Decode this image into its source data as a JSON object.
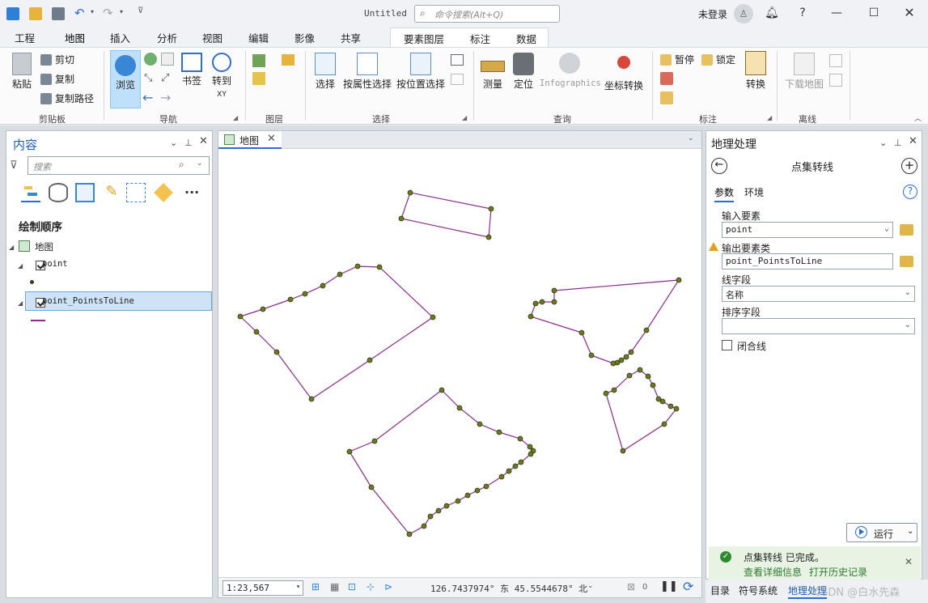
{
  "app": {
    "doc_title": "Untitled",
    "command_search_placeholder": "命令搜索(Alt+Q)",
    "login_label": "未登录",
    "help_label": "?"
  },
  "ribbon_tabs": [
    "工程",
    "地图",
    "插入",
    "分析",
    "视图",
    "编辑",
    "影像",
    "共享"
  ],
  "active_tab": "地图",
  "contextual_tabs": [
    "要素图层",
    "标注",
    "数据"
  ],
  "ribbon": {
    "clipboard": {
      "paste": "粘贴",
      "cut": "剪切",
      "copy": "复制",
      "copy_path": "复制路径",
      "group": "剪贴板"
    },
    "navigate": {
      "explore": "浏览",
      "bookmarks": "书签",
      "goto": "转到",
      "goto_sub": "XY",
      "group": "导航"
    },
    "layer": {
      "group": "图层"
    },
    "selection": {
      "select": "选择",
      "by_attr": "按属性选择",
      "by_loc": "按位置选择",
      "group": "选择"
    },
    "inquiry": {
      "measure": "测量",
      "locate": "定位",
      "infographics": "Infographics",
      "convert_coord": "坐标转换",
      "group": "查询"
    },
    "labeling": {
      "pause": "暂停",
      "lock": "锁定",
      "convert": "转换",
      "group": "标注"
    },
    "offline": {
      "download": "下载地图",
      "group": "离线"
    }
  },
  "contents_pane": {
    "title": "内容",
    "search_placeholder": "搜索",
    "drawing_order": "绘制顺序",
    "map_node": "地图",
    "layers": [
      {
        "name": "point",
        "checked": true
      },
      {
        "name": "point_PointsToLine",
        "checked": true,
        "selected": true
      }
    ]
  },
  "map_view": {
    "tab_label": "地图",
    "scale": "1:23,567",
    "coordinates": "126.7437974° 东  45.5544678° 北",
    "selected_count": "0"
  },
  "geoprocessing": {
    "title": "地理处理",
    "tool_name": "点集转线",
    "tabs": [
      "参数",
      "环境"
    ],
    "input_label": "输入要素",
    "input_value": "point",
    "output_label": "输出要素类",
    "output_value": "point_PointsToLine",
    "line_field_label": "线字段",
    "line_field_value": "名称",
    "sort_field_label": "排序字段",
    "sort_field_value": "",
    "close_line_label": "闭合线",
    "run_label": "运行",
    "message_title": "点集转线 已完成。",
    "message_details": "查看详细信息",
    "message_history": "打开历史记录"
  },
  "bottom_tabs": [
    "目录",
    "符号系统",
    "地理处理"
  ],
  "watermark": "CSDN @白水先森",
  "colors": {
    "accent": "#2b6cd3",
    "line": "#8b2a8b",
    "point": "#6b7a1e",
    "success": "#2f8a2f"
  }
}
